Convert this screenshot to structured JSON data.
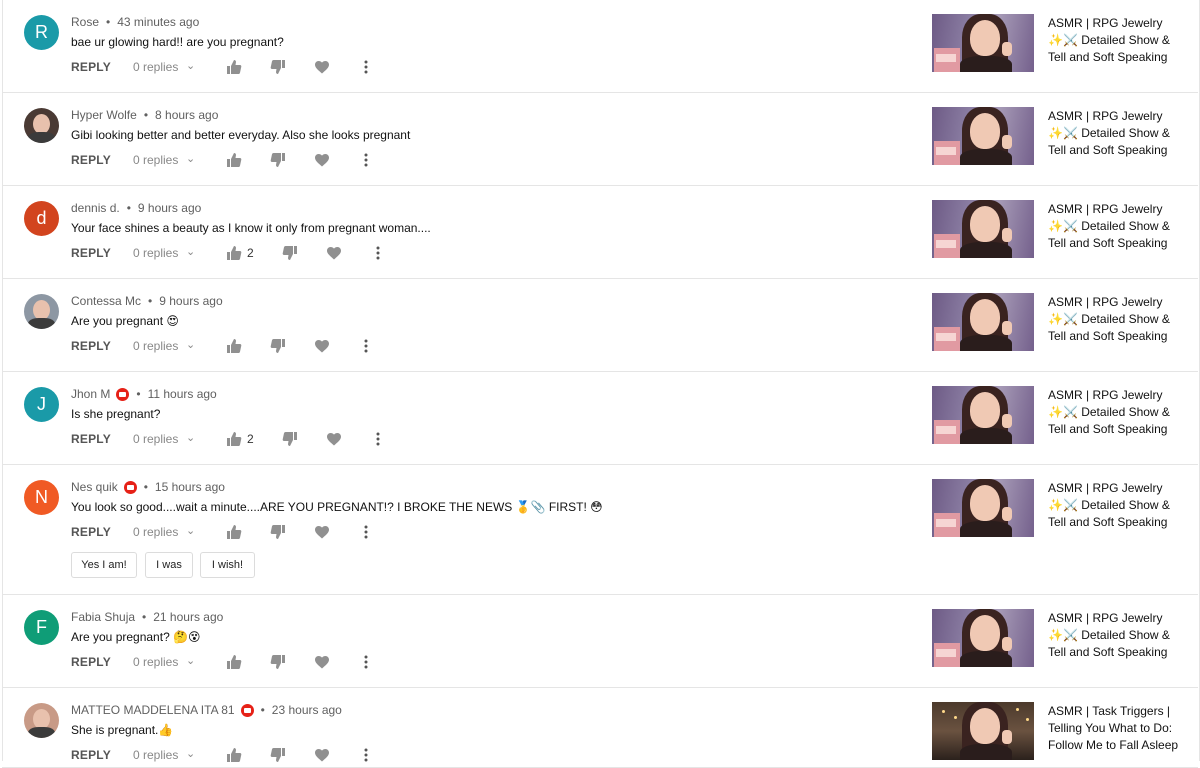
{
  "ui": {
    "reply_label": "REPLY",
    "replies_label": "0 replies",
    "separator": "•"
  },
  "comments": [
    {
      "author": "Rose",
      "time": "43 minutes ago",
      "text": "bae ur glowing hard!! are you pregnant?",
      "avatar_letter": "R",
      "avatar_color": "#1a9aa8",
      "likes": "",
      "verified_badge": false,
      "video_title": "ASMR | RPG Jewelry ✨⚔️ Detailed Show & Tell and Soft Speaking"
    },
    {
      "author": "Hyper Wolfe",
      "time": "8 hours ago",
      "text": "Gibi looking better and better everyday. Also she looks pregnant",
      "avatar_letter": "",
      "avatar_color": "#4a3a34",
      "likes": "",
      "verified_badge": false,
      "video_title": "ASMR | RPG Jewelry ✨⚔️ Detailed Show & Tell and Soft Speaking"
    },
    {
      "author": "dennis d.",
      "time": "9 hours ago",
      "text": "Your face shines a beauty as I know it only from pregnant woman....",
      "avatar_letter": "d",
      "avatar_color": "#d2441e",
      "likes": "2",
      "verified_badge": false,
      "video_title": "ASMR | RPG Jewelry ✨⚔️ Detailed Show & Tell and Soft Speaking"
    },
    {
      "author": "Contessa Mc",
      "time": "9 hours ago",
      "text": "Are you pregnant 😍",
      "avatar_letter": "",
      "avatar_color": "#8d97a3",
      "likes": "",
      "verified_badge": false,
      "video_title": "ASMR | RPG Jewelry ✨⚔️ Detailed Show & Tell and Soft Speaking"
    },
    {
      "author": "Jhon M",
      "time": "11 hours ago",
      "text": "Is she pregnant?",
      "avatar_letter": "J",
      "avatar_color": "#1a9aa8",
      "likes": "2",
      "verified_badge": true,
      "video_title": "ASMR | RPG Jewelry ✨⚔️ Detailed Show & Tell and Soft Speaking"
    },
    {
      "author": "Nes quik",
      "time": "15 hours ago",
      "text": "You look so good....wait a minute....ARE YOU PREGNANT!? I BROKE THE NEWS 🥇📎 FIRST! 😳",
      "avatar_letter": "N",
      "avatar_color": "#f05a24",
      "likes": "",
      "verified_badge": true,
      "chips": [
        "Yes I am!",
        "I was",
        "I wish!"
      ],
      "video_title": "ASMR | RPG Jewelry ✨⚔️ Detailed Show & Tell and Soft Speaking"
    },
    {
      "author": "Fabia Shuja",
      "time": "21 hours ago",
      "text": "Are you pregnant? 🤔😵",
      "avatar_letter": "F",
      "avatar_color": "#0f9d77",
      "likes": "",
      "verified_badge": false,
      "video_title": "ASMR | RPG Jewelry ✨⚔️ Detailed Show & Tell and Soft Speaking"
    },
    {
      "author": "MATTEO MADDELENA ITA 81",
      "time": "23 hours ago",
      "text": "She is pregnant.👍",
      "avatar_letter": "",
      "avatar_color": "#c89a86",
      "likes": "",
      "verified_badge": true,
      "video_title": "ASMR | Task Triggers | Telling You What to Do: Follow Me to Fall Asleep"
    }
  ]
}
